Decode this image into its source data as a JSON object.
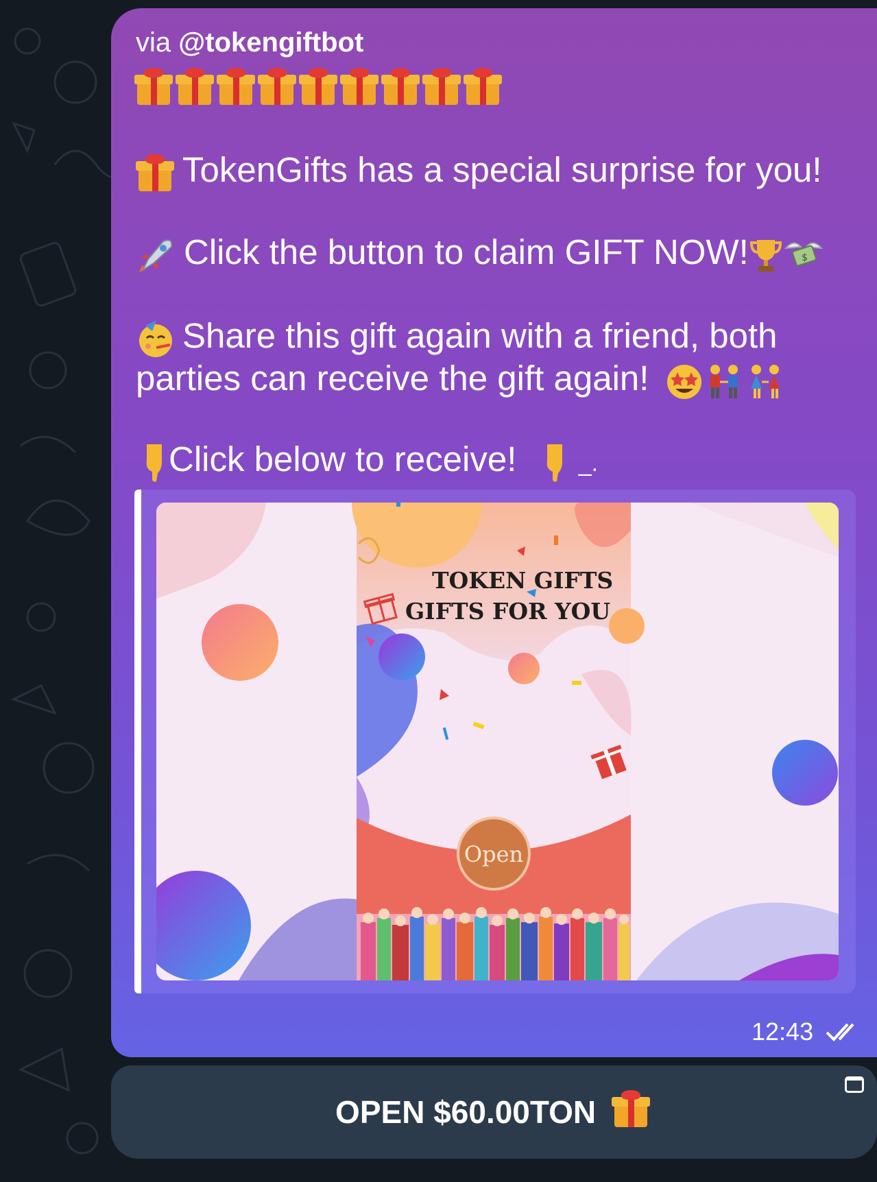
{
  "message": {
    "via_prefix": "via",
    "via_bot": "@tokengiftbot",
    "gift_row_count": 9,
    "line1": "TokenGifts has a special surprise for you!",
    "line2": "Click the button to claim GIFT NOW!",
    "line3a": "Share this gift again with a friend, both",
    "line3b": "parties can receive the gift again!",
    "line4": "Click below to receive!",
    "line4_tail": "_.",
    "time": "12:43"
  },
  "preview": {
    "title_line1": "TOKEN GIFTS",
    "title_line2": "GIFTS FOR YOU",
    "open_label": "Open"
  },
  "inline_button": {
    "label": "OPEN $60.00TON"
  },
  "icons": {
    "gift": "gift-emoji-icon",
    "rocket": "rocket-emoji-icon",
    "trophy": "trophy-emoji-icon",
    "money": "money-with-wings-emoji-icon",
    "party": "partying-face-emoji-icon",
    "star_eyes": "star-struck-emoji-icon",
    "couples": "people-holding-hands-emoji-icon",
    "point_down": "point-down-emoji-icon",
    "read": "double-check-icon",
    "link": "link-open-icon"
  },
  "colors": {
    "background": "#131a22",
    "bubble_top": "#9149b3",
    "bubble_bottom": "#6563e4",
    "button": "#2c3b4c"
  }
}
